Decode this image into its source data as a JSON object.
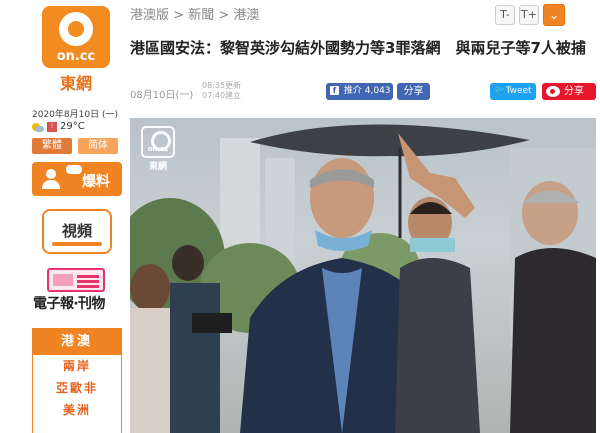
{
  "brand": {
    "logo_text": "on.cc",
    "name": "東網"
  },
  "sidebar": {
    "date": "2020年8月10日 (一)",
    "temperature": "29°C",
    "script_buttons": [
      "繁體",
      "简体"
    ],
    "tipoff_label": "爆料",
    "video_label": "視頻",
    "epaper_label": "電子報‧刊物",
    "nav_header": "港澳",
    "nav_items": [
      "兩岸",
      "亞歐非",
      "美洲"
    ]
  },
  "breadcrumb": {
    "items": [
      "港澳版",
      "新聞",
      "港澳"
    ],
    "separator": ">"
  },
  "controls": {
    "font_smaller": "T-",
    "font_larger": "T+",
    "collapse": "⌄"
  },
  "article": {
    "headline": "港區國安法：黎智英涉勾結外國勢力等3罪落網　與兩兒子等7人被捕",
    "date": "08月10日(一)",
    "updated": "08:35更新",
    "published": "07:40建立"
  },
  "social": {
    "facebook_label": "推介",
    "facebook_count": "4,043",
    "share_label": "分享",
    "twitter_label": "Tweet",
    "weibo_label": "分享"
  },
  "photo": {
    "watermark_logo": "on.cc",
    "watermark_name": "東網"
  },
  "colors": {
    "brand_orange": "#f08322",
    "facebook_blue": "#4267b2",
    "twitter_blue": "#1da1f2",
    "weibo_red": "#e6162d"
  }
}
